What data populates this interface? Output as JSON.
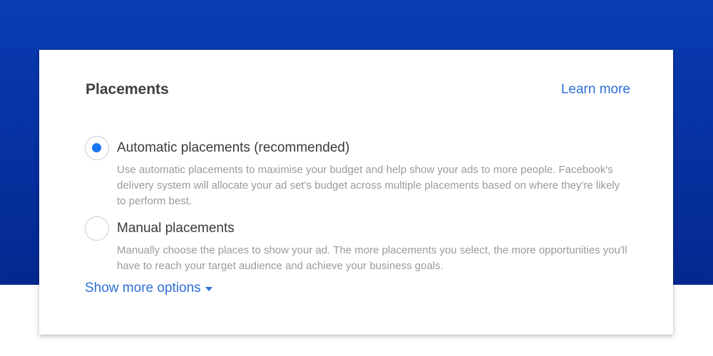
{
  "placements": {
    "title": "Placements",
    "learn_more": "Learn more",
    "options": [
      {
        "label": "Automatic placements (recommended)",
        "description": "Use automatic placements to maximise your budget and help show your ads to more people. Facebook's delivery system will allocate your ad set's budget across multiple placements based on where they're likely to perform best.",
        "selected": true
      },
      {
        "label": "Manual placements",
        "description": "Manually choose the places to show your ad. The more placements you select, the more opportunities you'll have to reach your target audience and achieve your business goals.",
        "selected": false
      }
    ],
    "show_more": "Show more options"
  },
  "icons": {
    "selected_radio": "radio-selected-icon",
    "unselected_radio": "radio-unselected-icon",
    "dropdown": "caret-down-icon"
  },
  "colors": {
    "background_band": "#0631a0",
    "link": "#2e6fd6",
    "radio_selected": "#1877f2",
    "heading_text": "#3f3f3f",
    "description_text": "#9a9a9a"
  }
}
